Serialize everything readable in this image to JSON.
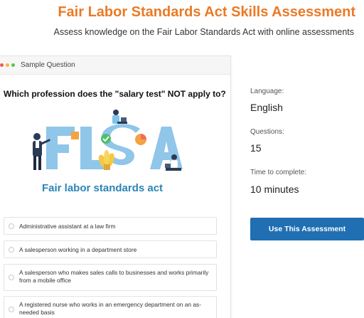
{
  "header": {
    "title": "Fair Labor Standards Act Skills Assessment",
    "subtitle": "Assess knowledge on the Fair Labor Standards Act with online assessments"
  },
  "sample_card": {
    "header_label": "Sample Question",
    "question": "Which profession does the \"salary test\" NOT apply to?",
    "illustration": {
      "caption": "Fair labor standards act",
      "logo_text": "FLSA"
    },
    "options": [
      "Administrative assistant at a law firm",
      "A salesperson working in a department store",
      "A salesperson who makes sales calls to businesses and works primarily from a mobile office",
      "A registered nurse who works in an emergency department on an as-needed basis"
    ]
  },
  "details": {
    "language_label": "Language:",
    "language_value": "English",
    "questions_label": "Questions:",
    "questions_value": "15",
    "time_label": "Time to complete:",
    "time_value": "10 minutes"
  },
  "cta": {
    "label": "Use This Assessment"
  },
  "colors": {
    "title": "#ea7a26",
    "button": "#1f6fb2",
    "illustration_blue": "#2d84b5"
  }
}
